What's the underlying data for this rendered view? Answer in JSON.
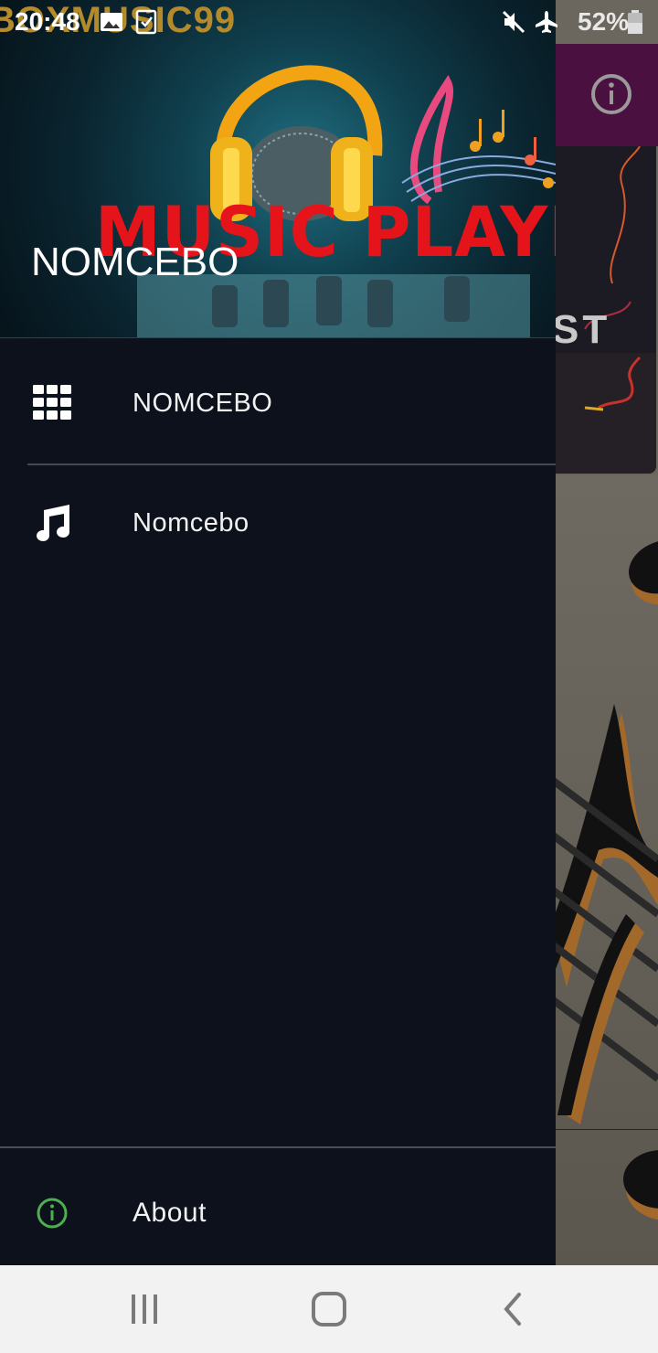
{
  "status_bar": {
    "time": "20:48",
    "battery": "52%",
    "icons": [
      "image-icon",
      "download-check-icon",
      "mute-icon",
      "airplane-icon",
      "battery-icon"
    ]
  },
  "background_app": {
    "toolbar_color": "#4a1040",
    "info_icon": "info-icon",
    "card_partial_text": "ST"
  },
  "drawer": {
    "header": {
      "watermark": "BOXMUSIC99",
      "banner": "MUSIC PLAYER",
      "title": "NOMCEBO"
    },
    "items": [
      {
        "icon": "grid-icon",
        "label": "NOMCEBO"
      },
      {
        "icon": "music-note-icon",
        "label": "Nomcebo"
      }
    ],
    "footer": {
      "icon": "info-icon",
      "label": "About",
      "icon_color": "#4caf50"
    }
  },
  "nav_bar": {
    "buttons": [
      "recent-apps-icon",
      "home-icon",
      "back-icon"
    ]
  }
}
